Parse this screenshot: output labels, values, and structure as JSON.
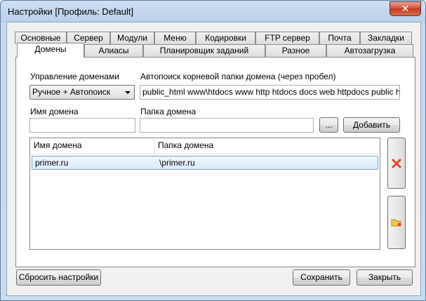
{
  "window": {
    "title": "Настройки [Профиль: Default]",
    "close_glyph": "✕"
  },
  "tabs_back": [
    "Основные",
    "Сервер",
    "Модули",
    "Меню",
    "Кодировки",
    "FTP сервер",
    "Почта",
    "Закладки"
  ],
  "tabs_front": [
    "Домены",
    "Алиасы",
    "Планировщик заданий",
    "Разное",
    "Автозагрузка"
  ],
  "active_tab": "Домены",
  "domains": {
    "management_label": "Управление доменами",
    "management_value": "Ручное + Автопоиск",
    "autosearch_label": "Автопоиск корневой папки домена (через пробел)",
    "autosearch_value": "public_html www\\htdocs www http htdocs docs web httpdocs public html site",
    "domain_name_label": "Имя домена",
    "domain_name_value": "",
    "domain_folder_label": "Папка домена",
    "domain_folder_value": "",
    "browse_label": "...",
    "add_label": "Добавить",
    "table": {
      "columns": [
        "Имя домена",
        "Папка домена"
      ],
      "rows": [
        {
          "name": "primer.ru",
          "folder": "\\primer.ru"
        }
      ]
    },
    "delete_icon": "delete-icon",
    "folder_icon": "folder-icon"
  },
  "footer": {
    "reset_label": "Сбросить настройки",
    "save_label": "Сохранить",
    "close_label": "Закрыть"
  },
  "colors": {
    "delete_red": "#e0462e",
    "folder_yellow": "#f2c94c"
  }
}
